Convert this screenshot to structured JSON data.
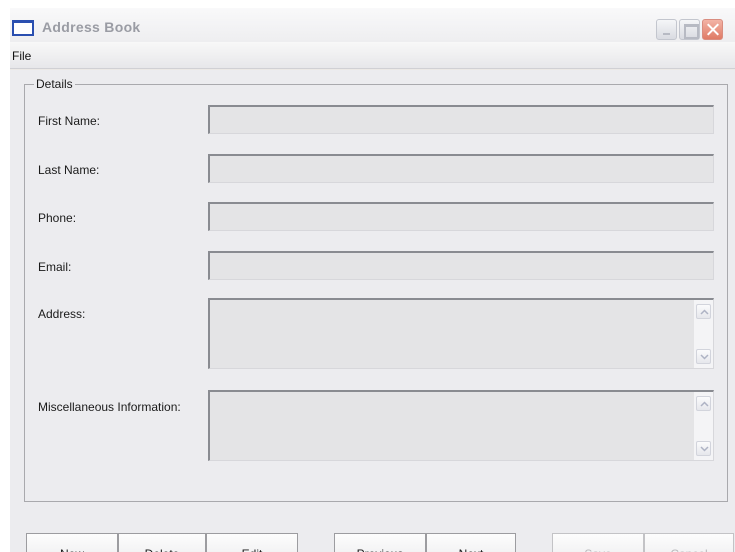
{
  "window": {
    "title": "Address Book"
  },
  "menu": {
    "file": "File"
  },
  "details": {
    "legend": "Details",
    "fields": {
      "first_name": {
        "label": "First Name:",
        "value": ""
      },
      "last_name": {
        "label": "Last Name:",
        "value": ""
      },
      "phone": {
        "label": "Phone:",
        "value": ""
      },
      "email": {
        "label": "Email:",
        "value": ""
      },
      "address": {
        "label": "Address:",
        "value": ""
      },
      "misc": {
        "label": "Miscellaneous Information:",
        "value": ""
      }
    }
  },
  "buttons": {
    "new": "New",
    "delete": "Delete",
    "edit": "Edit",
    "previous": "Previous",
    "next": "Next",
    "save": "Save",
    "cancel": "Cancel"
  },
  "states": {
    "save_enabled": false,
    "cancel_enabled": false,
    "fields_editable": false
  },
  "colors": {
    "window_bg": "#ececef",
    "field_bg": "#e4e4e6",
    "close_button": "#e07a65",
    "title_text": "#9a9ca4"
  }
}
